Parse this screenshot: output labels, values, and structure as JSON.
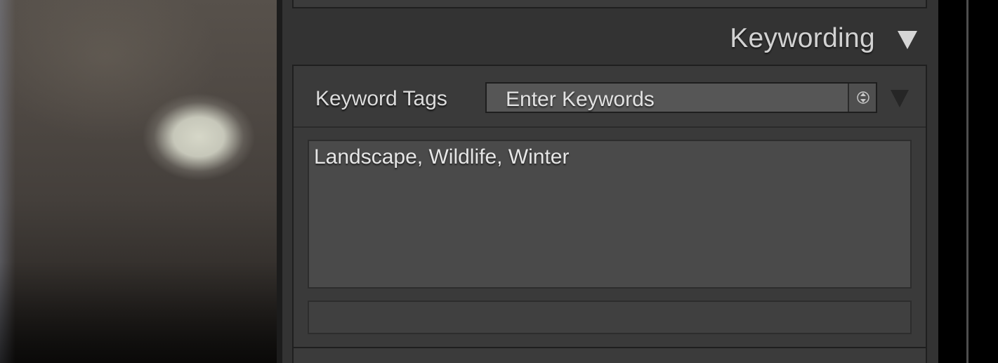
{
  "keywording_panel": {
    "title": "Keywording",
    "collapse_icon": "triangle-down-icon",
    "keyword_tags": {
      "label": "Keyword Tags",
      "selected_option": "Enter Keywords",
      "stepper_icon": "up-down-stepper-icon",
      "menu_icon": "triangle-down-icon"
    },
    "keywords_text": "Landscape, Wildlife, Winter",
    "add_keyword_input_value": ""
  },
  "colors": {
    "panel_background": "#333333",
    "section_background": "#3a3a3a",
    "text_primary": "#dcdcdc"
  }
}
